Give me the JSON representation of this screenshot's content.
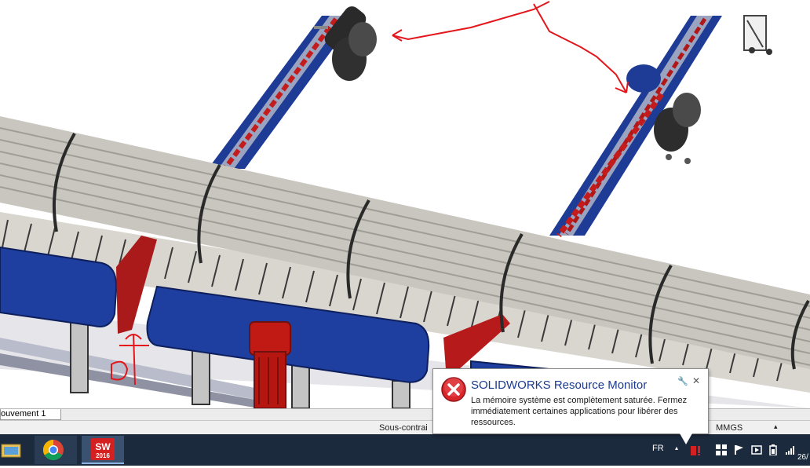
{
  "viewport": {
    "description_icons": [
      "conveyor-assembly-model",
      "red-markup-arrow"
    ],
    "colors": {
      "roller": "#c9c6c0",
      "frame_blue": "#1e3c96",
      "chain_red": "#c41c1c",
      "motor_red": "#c11a14",
      "markup": "#e3161c"
    }
  },
  "tabs": {
    "active_tab": "ouvement 1"
  },
  "status_bar": {
    "status_text": "Sous-contrai",
    "units": "MMGS",
    "units_caret": "▴"
  },
  "taskbar": {
    "apps": [
      {
        "name": "file-explorer",
        "icon": "explorer-icon"
      },
      {
        "name": "google-chrome",
        "icon": "chrome-icon"
      },
      {
        "name": "solidworks-2016",
        "icon": "solidworks-icon",
        "label": "2016"
      }
    ],
    "tray": {
      "language": "FR",
      "caret": "▴",
      "clock": "26/"
    }
  },
  "notification": {
    "title": "SOLIDWORKS Resource Monitor",
    "message": "La mémoire système est complètement saturée. Fermez immédiatement certaines applications pour libérer des ressources.",
    "settings_glyph": "🔧",
    "close_glyph": "✕",
    "icon": "error-icon"
  }
}
